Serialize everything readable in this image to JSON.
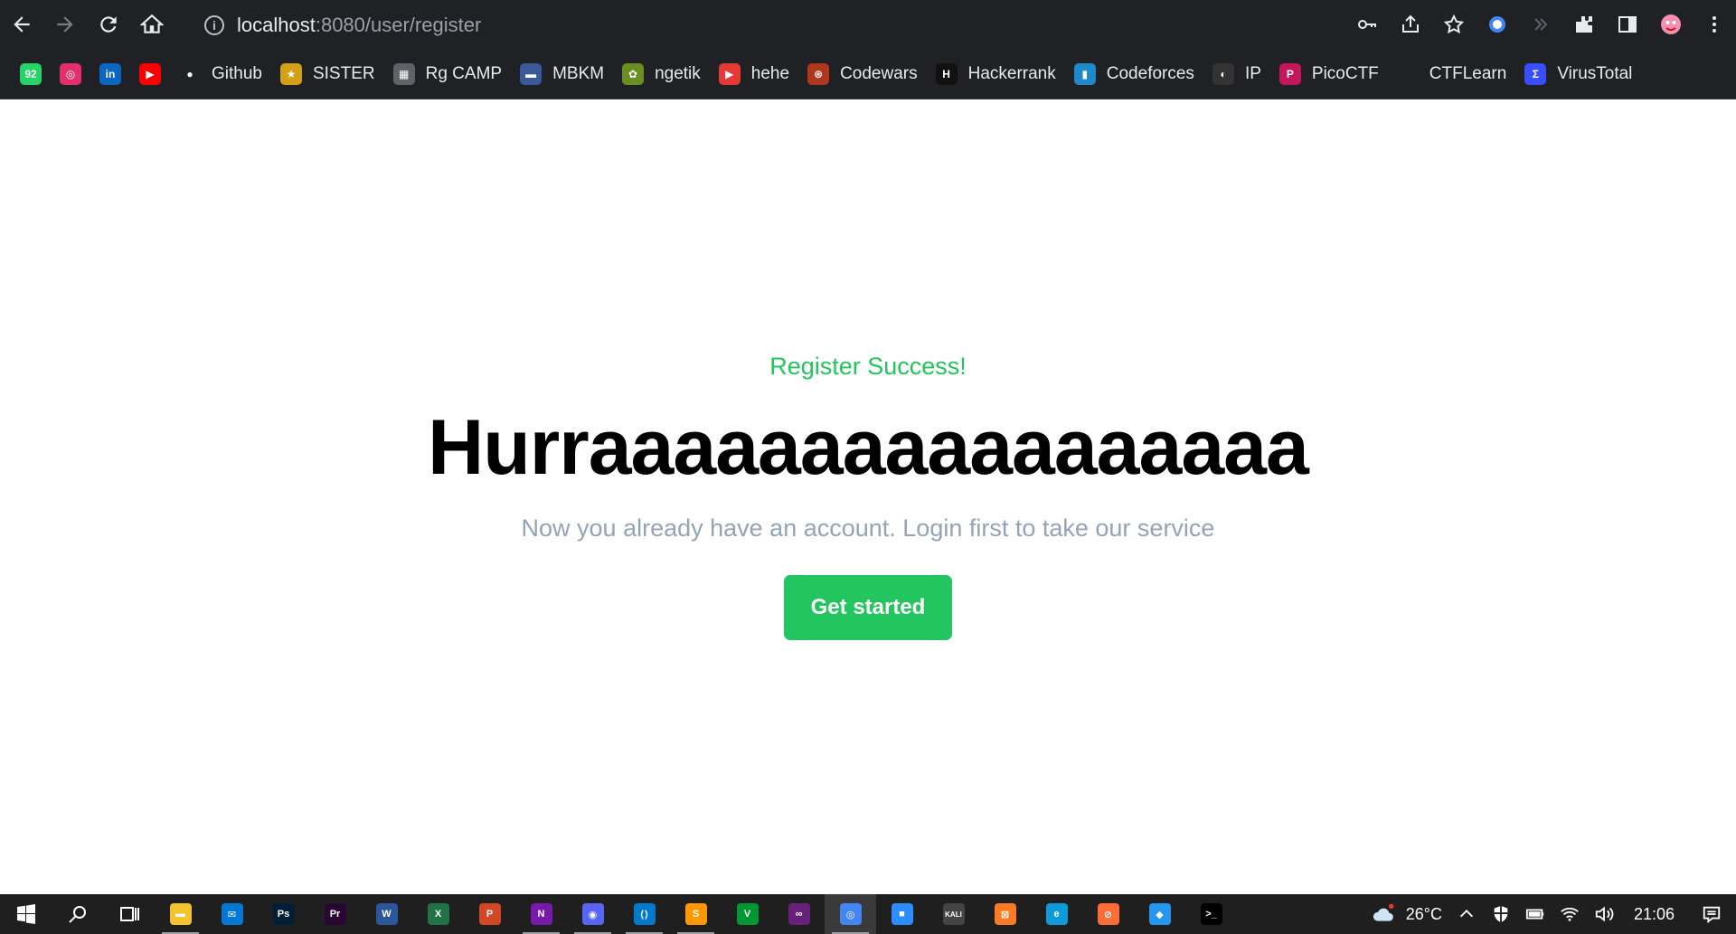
{
  "browser": {
    "url_host": "localhost",
    "url_path": ":8080/user/register"
  },
  "bookmarks": [
    {
      "label": "",
      "color": "#25d366",
      "glyph": "92",
      "icon": "whatsapp-icon"
    },
    {
      "label": "",
      "color": "#e1306c",
      "glyph": "◎",
      "icon": "instagram-icon"
    },
    {
      "label": "",
      "color": "#0a66c2",
      "glyph": "in",
      "icon": "linkedin-icon"
    },
    {
      "label": "",
      "color": "#ff0000",
      "glyph": "▶",
      "icon": "youtube-icon"
    },
    {
      "label": "Github",
      "color": "#202124",
      "glyph": "●",
      "icon": "github-icon"
    },
    {
      "label": "SISTER",
      "color": "#d4a017",
      "glyph": "★",
      "icon": "sister-icon"
    },
    {
      "label": "Rg CAMP",
      "color": "#5f6368",
      "glyph": "▦",
      "icon": "rgcamp-icon"
    },
    {
      "label": "MBKM",
      "color": "#3b5998",
      "glyph": "▬",
      "icon": "mbkm-icon"
    },
    {
      "label": "ngetik",
      "color": "#6b8e23",
      "glyph": "✿",
      "icon": "ngetik-icon"
    },
    {
      "label": "hehe",
      "color": "#e53935",
      "glyph": "▶",
      "icon": "hehe-icon"
    },
    {
      "label": "Codewars",
      "color": "#b1361e",
      "glyph": "⊛",
      "icon": "codewars-icon"
    },
    {
      "label": "Hackerrank",
      "color": "#111111",
      "glyph": "H",
      "icon": "hackerrank-icon"
    },
    {
      "label": "Codeforces",
      "color": "#1f8acb",
      "glyph": "▮",
      "icon": "codeforces-icon"
    },
    {
      "label": "IP",
      "color": "#333333",
      "glyph": "◐",
      "icon": "ip-icon"
    },
    {
      "label": "PicoCTF",
      "color": "#c2185b",
      "glyph": "P",
      "icon": "picoctf-icon"
    },
    {
      "label": "CTFLearn",
      "color": "#202124",
      "glyph": "",
      "icon": "ctflearn-icon"
    },
    {
      "label": "VirusTotal",
      "color": "#394eff",
      "glyph": "Σ",
      "icon": "virustotal-icon"
    }
  ],
  "page": {
    "kicker": "Register Success!",
    "headline": "Hurraaaaaaaaaaaaaaaaa",
    "subtitle": "Now you already have an account. Login first to take our service",
    "cta_label": "Get started"
  },
  "taskbar": {
    "apps": [
      {
        "name": "file-explorer",
        "color": "#f4c430",
        "glyph": "▬"
      },
      {
        "name": "mail",
        "color": "#0078d4",
        "glyph": "✉"
      },
      {
        "name": "photoshop",
        "color": "#001e36",
        "glyph": "Ps"
      },
      {
        "name": "premiere",
        "color": "#2a0634",
        "glyph": "Pr"
      },
      {
        "name": "word",
        "color": "#2b579a",
        "glyph": "W"
      },
      {
        "name": "excel",
        "color": "#217346",
        "glyph": "X"
      },
      {
        "name": "powerpoint",
        "color": "#d24726",
        "glyph": "P"
      },
      {
        "name": "onenote",
        "color": "#7719aa",
        "glyph": "N"
      },
      {
        "name": "discord",
        "color": "#5865f2",
        "glyph": "◉"
      },
      {
        "name": "vscode",
        "color": "#007acc",
        "glyph": "⟨⟩"
      },
      {
        "name": "sublime",
        "color": "#ff9800",
        "glyph": "S"
      },
      {
        "name": "vim",
        "color": "#019833",
        "glyph": "V"
      },
      {
        "name": "visual-studio",
        "color": "#68217a",
        "glyph": "∞"
      },
      {
        "name": "chrome",
        "color": "#4285f4",
        "glyph": "◎"
      },
      {
        "name": "zoom",
        "color": "#2d8cff",
        "glyph": "■"
      },
      {
        "name": "kali",
        "color": "#444444",
        "glyph": "KALI"
      },
      {
        "name": "xampp",
        "color": "#fb7a24",
        "glyph": "⊠"
      },
      {
        "name": "edge",
        "color": "#0c9ad8",
        "glyph": "e"
      },
      {
        "name": "postman",
        "color": "#ff6c37",
        "glyph": "⊘"
      },
      {
        "name": "docker",
        "color": "#2496ed",
        "glyph": "◆"
      },
      {
        "name": "terminal",
        "color": "#000000",
        "glyph": ">_"
      }
    ],
    "weather": "26°C",
    "time": "21:06"
  }
}
